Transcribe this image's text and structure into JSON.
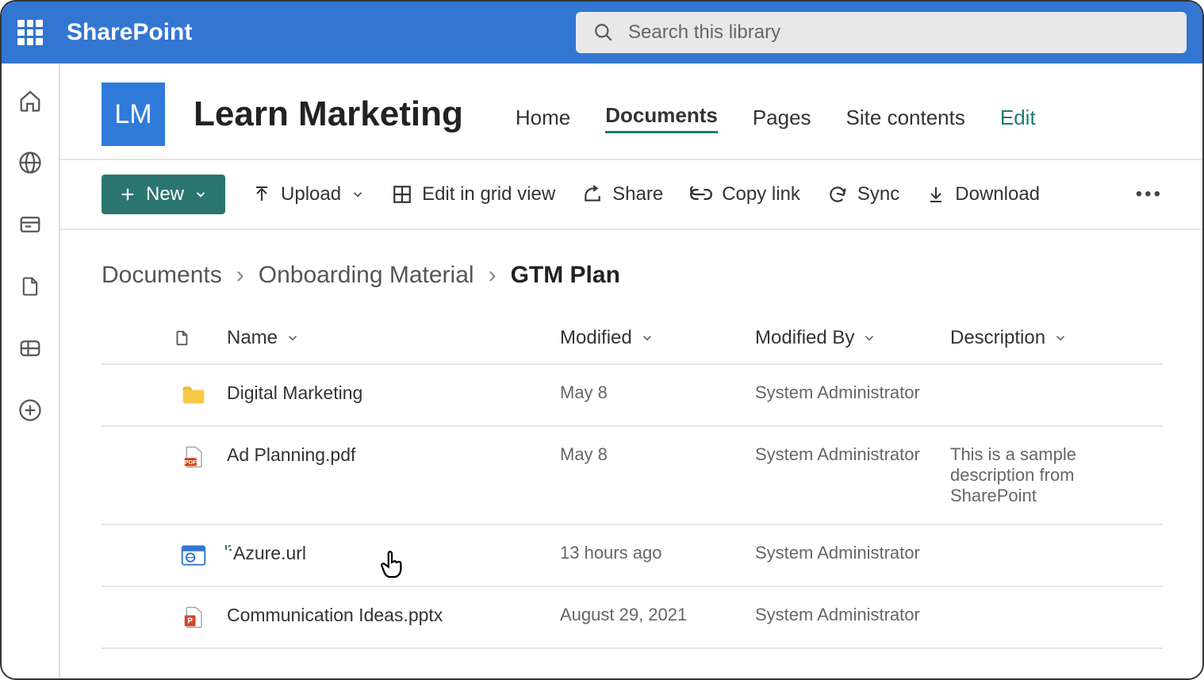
{
  "suite": {
    "brand": "SharePoint",
    "search_placeholder": "Search this library"
  },
  "site": {
    "logo_initials": "LM",
    "title": "Learn Marketing",
    "nav": [
      {
        "label": "Home"
      },
      {
        "label": "Documents",
        "active": true
      },
      {
        "label": "Pages"
      },
      {
        "label": "Site contents"
      },
      {
        "label": "Edit",
        "edit": true
      }
    ]
  },
  "commands": {
    "new": "New",
    "upload": "Upload",
    "grid": "Edit in grid view",
    "share": "Share",
    "copy": "Copy link",
    "sync": "Sync",
    "download": "Download"
  },
  "breadcrumb": [
    {
      "label": "Documents"
    },
    {
      "label": "Onboarding Material"
    },
    {
      "label": "GTM Plan",
      "current": true
    }
  ],
  "columns": {
    "name": "Name",
    "modified": "Modified",
    "modified_by": "Modified By",
    "description": "Description"
  },
  "rows": [
    {
      "icon": "folder",
      "name": "Digital Marketing",
      "modified": "May 8",
      "modified_by": "System Administrator",
      "description": ""
    },
    {
      "icon": "pdf",
      "name": "Ad Planning.pdf",
      "modified": "May 8",
      "modified_by": "System Administrator",
      "description": "This is a sample description from SharePoint"
    },
    {
      "icon": "url",
      "name": "Azure.url",
      "modified": "13 hours ago",
      "modified_by": "System Administrator",
      "description": "",
      "new": true
    },
    {
      "icon": "pptx",
      "name": "Communication Ideas.pptx",
      "modified": "August 29, 2021",
      "modified_by": "System Administrator",
      "description": ""
    }
  ]
}
